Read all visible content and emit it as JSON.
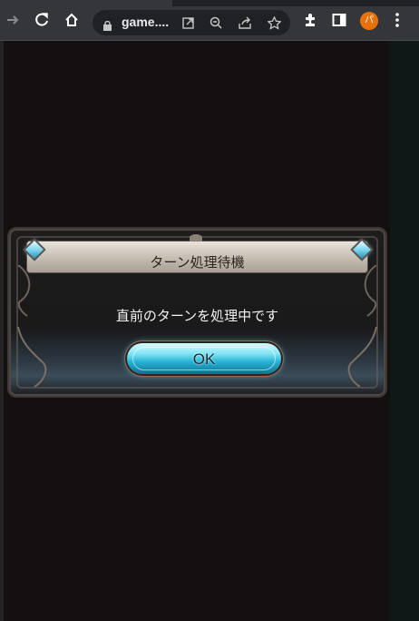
{
  "browser": {
    "url_text": "game....",
    "avatar_initial": "パ",
    "colors": {
      "toolbar": "#35363a",
      "omnibox": "#202124",
      "avatar": "#e8710a"
    }
  },
  "dialog": {
    "title": "ターン処理待機",
    "message": "直前のターンを処理中です",
    "ok_label": "OK"
  }
}
